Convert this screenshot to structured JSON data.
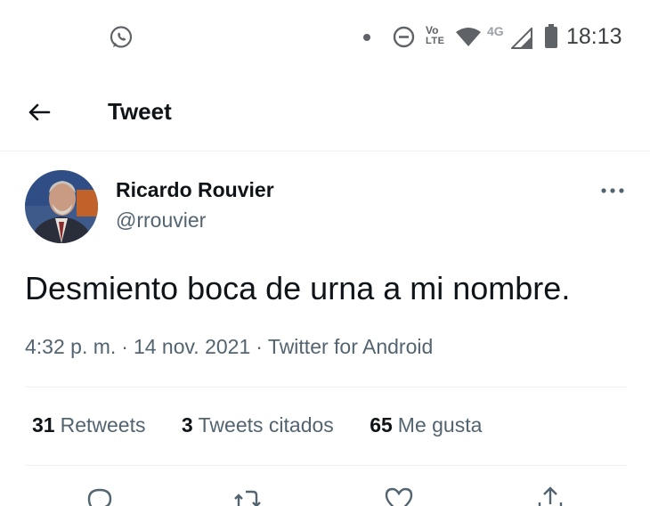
{
  "status_bar": {
    "time": "18:13",
    "network": "4G",
    "volte_line1": "Vo",
    "volte_line2": "LTE",
    "icons": [
      "whatsapp-icon",
      "dot-icon",
      "do-not-disturb-icon",
      "volte-icon",
      "wifi-icon",
      "signal-icon",
      "battery-icon"
    ]
  },
  "header": {
    "title": "Tweet",
    "back_icon": "back-arrow-icon"
  },
  "tweet": {
    "author_name": "Ricardo Rouvier",
    "author_handle": "@rrouvier",
    "text": "Desmiento boca de urna a mi nombre.",
    "time": "4:32 p. m.",
    "date": "14 nov. 2021",
    "source": "Twitter for Android",
    "separator": "·",
    "more_icon": "more-options-icon"
  },
  "stats": [
    {
      "count": "31",
      "label": "Retweets"
    },
    {
      "count": "3",
      "label": "Tweets citados"
    },
    {
      "count": "65",
      "label": "Me gusta"
    }
  ],
  "actions": [
    "reply-icon",
    "retweet-icon",
    "like-icon",
    "share-icon"
  ],
  "colors": {
    "text_primary": "#0f1419",
    "text_secondary": "#536471",
    "divider": "#eff3f4",
    "status_icons": "#5f6368"
  }
}
